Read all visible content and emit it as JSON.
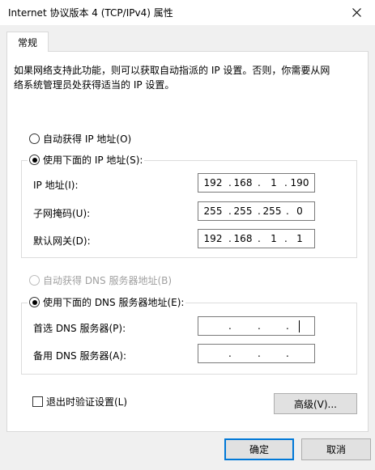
{
  "window": {
    "title": "Internet 协议版本 4 (TCP/IPv4) 属性",
    "close_glyph": "×"
  },
  "tab": {
    "label": "常规"
  },
  "description_line1": "如果网络支持此功能，则可以获取自动指派的 IP 设置。否则，你需要从网",
  "description_line2": "络系统管理员处获得适当的 IP 设置。",
  "ip_auto_radio": {
    "label": "自动获得 IP 地址(O)",
    "checked": false
  },
  "ip_manual_radio": {
    "label": "使用下面的 IP 地址(S):",
    "checked": true
  },
  "ip_fields": [
    {
      "label": "IP 地址(I):",
      "octets": [
        "192",
        "168",
        "1",
        "190"
      ]
    },
    {
      "label": "子网掩码(U):",
      "octets": [
        "255",
        "255",
        "255",
        "0"
      ]
    },
    {
      "label": "默认网关(D):",
      "octets": [
        "192",
        "168",
        "1",
        "1"
      ]
    }
  ],
  "dns_auto_radio": {
    "label": "自动获得 DNS 服务器地址(B)",
    "checked": false,
    "enabled": false
  },
  "dns_manual_radio": {
    "label": "使用下面的 DNS 服务器地址(E):",
    "checked": true
  },
  "dns_fields": [
    {
      "label": "首选 DNS 服务器(P):",
      "octets": [
        "",
        "",
        "",
        ""
      ]
    },
    {
      "label": "备用 DNS 服务器(A):",
      "octets": [
        "",
        "",
        "",
        ""
      ]
    }
  ],
  "validate_checkbox": {
    "label": "退出时验证设置(L)",
    "checked": false
  },
  "advanced_button": {
    "label": "高级(V)..."
  },
  "ok_button": {
    "label": "确定"
  },
  "cancel_button": {
    "label": "取消"
  },
  "colors": {
    "accent": "#0078d7",
    "dialog_bg": "#f0f0f0",
    "panel_bg": "#ffffff",
    "disabled_text": "#a0a0a0"
  }
}
